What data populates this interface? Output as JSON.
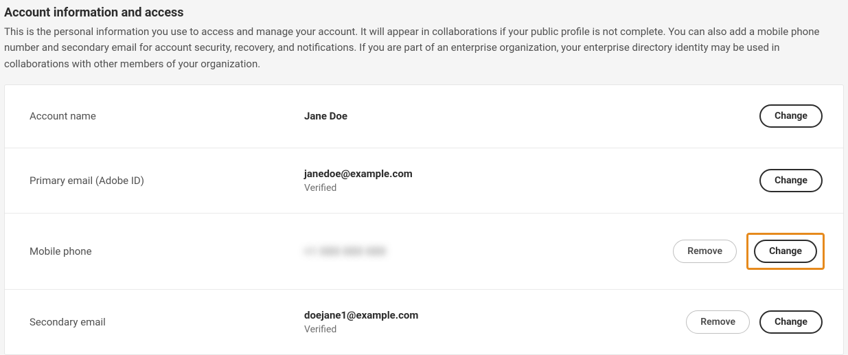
{
  "section": {
    "title": "Account information and access",
    "description": "This is the personal information you use to access and manage your account. It will appear in collaborations if your public profile is not complete. You can also add a mobile phone number and secondary email for account security, recovery, and notifications. If you are part of an enterprise organization, your enterprise directory identity may be used in collaborations with other members of your organization."
  },
  "rows": {
    "accountName": {
      "label": "Account name",
      "value": "Jane Doe",
      "changeLabel": "Change"
    },
    "primaryEmail": {
      "label": "Primary email (Adobe ID)",
      "value": "janedoe@example.com",
      "status": "Verified",
      "changeLabel": "Change"
    },
    "mobilePhone": {
      "label": "Mobile phone",
      "value": "+1 000 000 000",
      "removeLabel": "Remove",
      "changeLabel": "Change"
    },
    "secondaryEmail": {
      "label": "Secondary email",
      "value": "doejane1@example.com",
      "status": "Verified",
      "removeLabel": "Remove",
      "changeLabel": "Change"
    }
  }
}
